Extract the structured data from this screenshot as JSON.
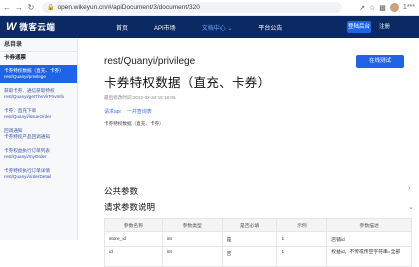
{
  "browser": {
    "url": "open.wikeyun.cn/#/apiDocument/3/document/320",
    "account": "1***"
  },
  "nav": {
    "logo_mark": "W",
    "logo_text": "微客云端",
    "items": [
      {
        "label": "首页",
        "active": false
      },
      {
        "label": "API市场",
        "active": false
      },
      {
        "label": "文档中心 ⌄",
        "active": true
      },
      {
        "label": "平台公告",
        "active": false
      }
    ],
    "login": "登陆后台",
    "register": "注册"
  },
  "sidebar": {
    "title": "总目录",
    "group": "卡券通票",
    "items": [
      {
        "line1": "卡券特权数据（直充、卡券）",
        "line2": "rest/Quanyi/privilege",
        "active": true
      },
      {
        "line1": "获取卡券、通信获取特权",
        "line2": "rest/Quanyi/getTheVirPrivInfo",
        "active": false
      },
      {
        "line1": "卡券、直充下单",
        "line2": "rest/Quanyi/issueOrder",
        "active": false
      },
      {
        "line1": "回调通知",
        "line2": "卡券特权产品回调通知",
        "active": false
      },
      {
        "line1": "卡券权益执行订单列表",
        "line2": "rest/Quanyi/myOrder",
        "active": false
      },
      {
        "line1": "卡券特权执行订单详情",
        "line2": "rest/Quanyi/orderDetail",
        "active": false
      }
    ]
  },
  "main": {
    "online_button": "在线测试",
    "path": "rest/Quanyi/privilege",
    "title": "卡券特权数据（直充、卡券）",
    "meta": "最后修改时间:2022-02-24 15:18:06",
    "tags": [
      "请求api",
      "一并查询表"
    ],
    "description": "卡券特权数据（直充、卡券）",
    "section_public": "公共参数",
    "section_request": "请求参数说明",
    "table": {
      "headers": [
        "参数名称",
        "参数类型",
        "是否必填",
        "示例",
        "参数描述"
      ],
      "rows": [
        [
          "store_id",
          "int",
          "是",
          "1",
          "店铺id"
        ],
        [
          "id",
          "int",
          "否",
          "1",
          "权益id，不传或传空字符串=全部"
        ]
      ]
    }
  },
  "colors": {
    "nav_bg": "#0b2a63",
    "accent": "#1f63e6",
    "link": "#3d56a6"
  }
}
